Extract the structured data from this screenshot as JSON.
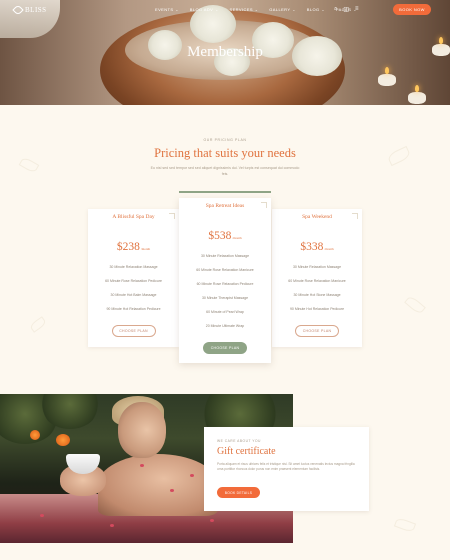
{
  "header": {
    "logo_text": "BLISS",
    "nav": [
      {
        "label": "EVENTS"
      },
      {
        "label": "BLOG ADV"
      },
      {
        "label": "SERVICES"
      },
      {
        "label": "GALLERY"
      },
      {
        "label": "BLOG"
      },
      {
        "label": "PAGES"
      }
    ],
    "book_label": "BOOK NOW"
  },
  "hero": {
    "title": "Membership"
  },
  "pricing": {
    "eyebrow": "OUR PRICING PLAN",
    "title": "Pricing that suits your needs",
    "subtitle": "Eu nisl sed sed tempor sed sed aliquet dignissimis dui. Vel turpis est consequat dui commodo feis.",
    "plans": [
      {
        "name": "A Blissful Spa Day",
        "price": "$238",
        "period": "/month",
        "features": [
          "30 Minute Relaxation Massage",
          "60 Minute Rose Relaxation Pedicure",
          "30 Minute Hot Balm Massage",
          "90 Minute Hot Relaxation Pedicure"
        ],
        "button": "CHOOSE PLAN"
      },
      {
        "name": "Spa Retreat Ideas",
        "price": "$538",
        "period": "/month",
        "features": [
          "30 Minute Relaxation Massage",
          "60 Minute Rose Relaxation Manicure",
          "60 Minute Rose Relaxation Pedicure",
          "30 Minute Therapist Massage",
          "60 Minute of Pearl Wrap",
          "20 Minute Ultimate Wrap"
        ],
        "button": "CHOOSE PLAN"
      },
      {
        "name": "Spa Weekend",
        "price": "$338",
        "period": "/month",
        "features": [
          "30 Minute Relaxation Massage",
          "60 Minute Rose Relaxation Manicure",
          "30 Minute Hot Stone Massage",
          "90 Minute Hot Relaxation Pedicure"
        ],
        "button": "CHOOSE PLAN"
      }
    ]
  },
  "gift": {
    "eyebrow": "WE CARE ABOUT YOU",
    "title": "Gift certificate",
    "text": "Porta aliquam et risus ultrices felis et tristique nisl. Sit amet luctus venenatis lectus magna fringilla urna porttitor rhoncus dolor purus non enim praesent elementum facilisis.",
    "button": "BOOK DETAILS"
  },
  "colors": {
    "accent": "#f26b3a",
    "title": "#e0733f",
    "sage": "#8fa486",
    "background": "#fdf8ef"
  },
  "icons": [
    "search-icon",
    "bag-icon",
    "menu-icon"
  ]
}
